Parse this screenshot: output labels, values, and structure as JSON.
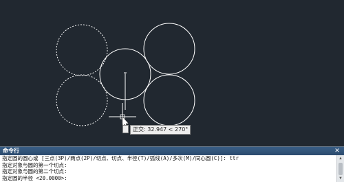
{
  "canvas": {
    "background": "#212830",
    "tooltip": "正交: 32.947 < 270°",
    "crosshair_icon": "crosshair-cursor",
    "colors": {
      "circle": "#ffffff",
      "dashed": "#ffffff"
    }
  },
  "command_panel": {
    "title": "命令行",
    "close_icon": "close-icon",
    "lines": [
      "指定圆的圆心或 [三点(3P)/两点(2P)/切点、切点、半径(T)/弧线(A)/多次(M)/同心圆(C)]: ttr",
      "指定对象与圆的第一个切点:",
      "指定对象与圆的第二个切点:",
      "指定圆的半径 <20.0000>:"
    ]
  }
}
